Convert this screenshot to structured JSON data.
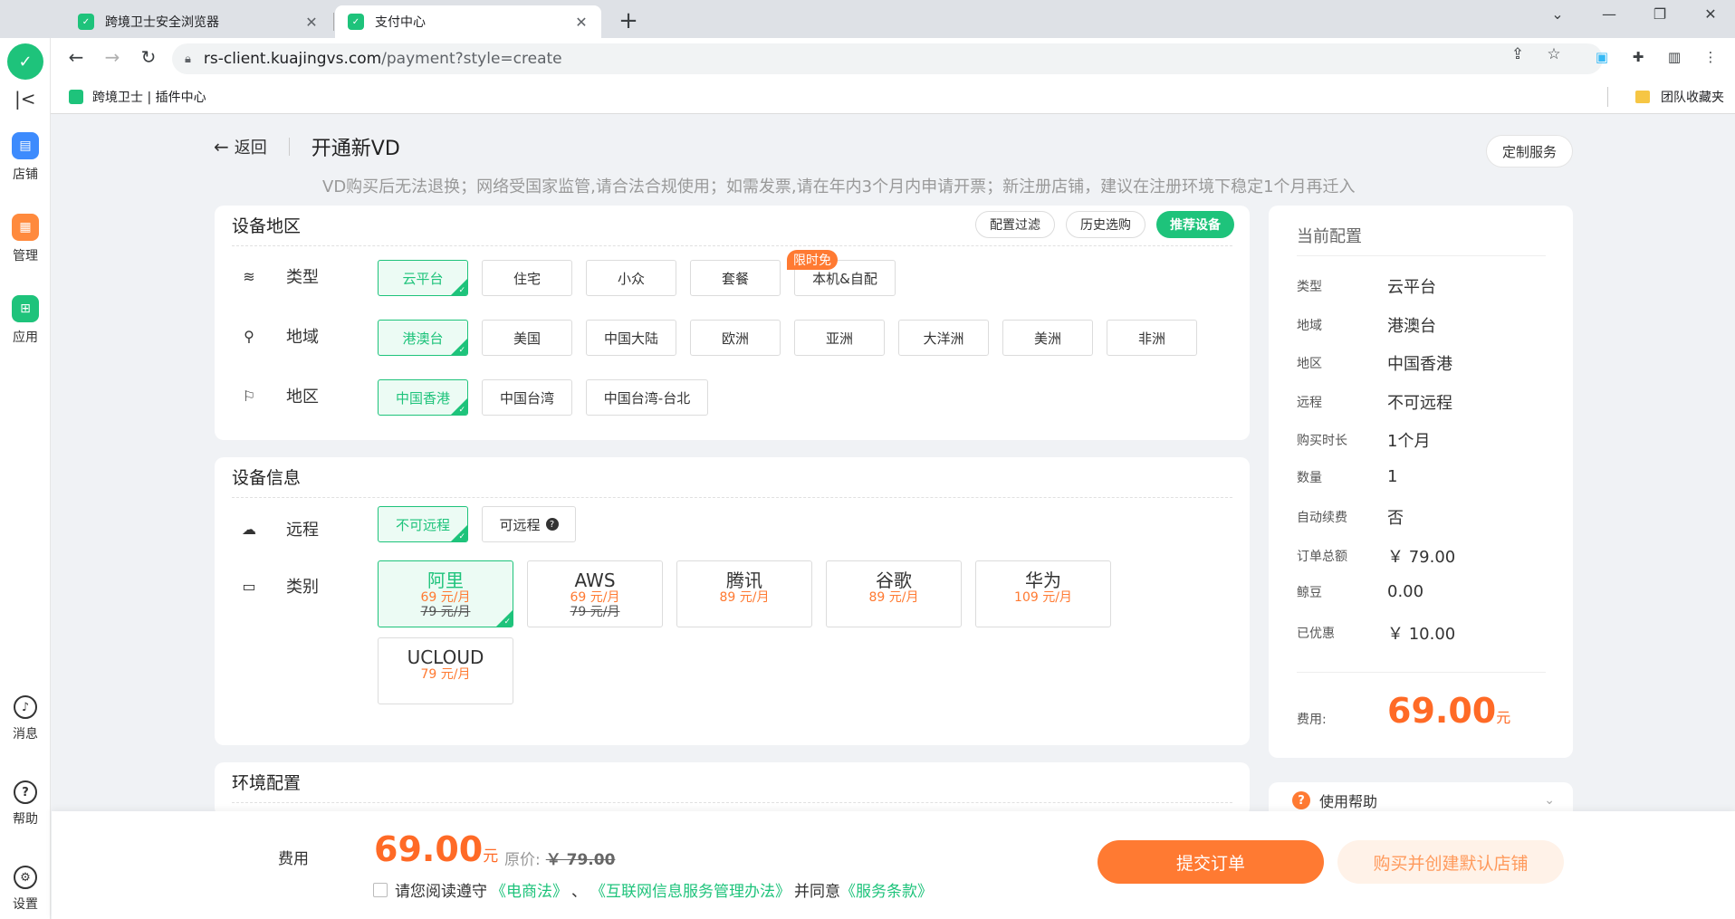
{
  "browser": {
    "tabs": [
      {
        "title": "跨境卫士安全浏览器",
        "active": false
      },
      {
        "title": "支付中心",
        "active": true
      }
    ],
    "url_host": "rs-client.kuajingvs.com",
    "url_path": "/payment?style=create",
    "bookmarks": {
      "left_label": "跨境卫士 | 插件中心",
      "right_label": "团队收藏夹"
    }
  },
  "sidebar": {
    "items": [
      {
        "label": "店铺",
        "color": "#3d8bfd"
      },
      {
        "label": "管理",
        "color": "#ff8a3d"
      },
      {
        "label": "应用",
        "color": "#1ec37b"
      }
    ],
    "bottom_items": [
      {
        "label": "消息"
      },
      {
        "label": "帮助"
      },
      {
        "label": "设置"
      }
    ]
  },
  "header": {
    "back_label": "返回",
    "title": "开通新VD",
    "notice": "VD购买后无法退换；网络受国家监管,请合法合规使用；如需发票,请在年内3个月内申请开票；新注册店铺，建议在注册环境下稳定1个月再迁入",
    "custom_service": "定制服务"
  },
  "region_card": {
    "title": "设备地区",
    "actions": [
      "配置过滤",
      "历史选购",
      "推荐设备"
    ],
    "type": {
      "label": "类型",
      "options": [
        "云平台",
        "住宅",
        "小众",
        "套餐",
        "本机&自配"
      ],
      "selected": "云平台",
      "badge": "限时免"
    },
    "area": {
      "label": "地域",
      "options": [
        "港澳台",
        "美国",
        "中国大陆",
        "欧洲",
        "亚洲",
        "大洋洲",
        "美洲",
        "非洲"
      ],
      "selected": "港澳台"
    },
    "region": {
      "label": "地区",
      "options": [
        "中国香港",
        "中国台湾",
        "中国台湾-台北"
      ],
      "selected": "中国香港"
    }
  },
  "device_card": {
    "title": "设备信息",
    "remote": {
      "label": "远程",
      "options": [
        "不可远程",
        "可远程"
      ],
      "selected": "不可远程"
    },
    "category": {
      "label": "类别",
      "vendors": [
        {
          "name": "阿里",
          "price": "69 元/月",
          "orig": "79 元/月",
          "selected": true
        },
        {
          "name": "AWS",
          "price": "69 元/月",
          "orig": "79 元/月",
          "selected": false
        },
        {
          "name": "腾讯",
          "price": "89 元/月",
          "orig": "",
          "selected": false
        },
        {
          "name": "谷歌",
          "price": "89 元/月",
          "orig": "",
          "selected": false
        },
        {
          "name": "华为",
          "price": "109 元/月",
          "orig": "",
          "selected": false
        },
        {
          "name": "UCLOUD",
          "price": "79 元/月",
          "orig": "",
          "selected": false
        }
      ]
    }
  },
  "env_card": {
    "title": "环境配置"
  },
  "summary": {
    "title": "当前配置",
    "rows": [
      {
        "k": "类型",
        "v": "云平台"
      },
      {
        "k": "地域",
        "v": "港澳台"
      },
      {
        "k": "地区",
        "v": "中国香港"
      },
      {
        "k": "远程",
        "v": "不可远程"
      },
      {
        "k": "购买时长",
        "v": "1个月"
      },
      {
        "k": "数量",
        "v": "1"
      },
      {
        "k": "自动续费",
        "v": "否"
      },
      {
        "k": "订单总额",
        "v": "￥ 79.00"
      },
      {
        "k": "鲸豆",
        "v": "0.00"
      },
      {
        "k": "已优惠",
        "v": "￥ 10.00"
      }
    ],
    "fee_label": "费用:",
    "fee_value": "69.00",
    "fee_unit": "元"
  },
  "help": {
    "label": "使用帮助"
  },
  "bottom": {
    "fee_label": "费用",
    "fee_value": "69.00",
    "fee_unit": "元",
    "orig_label": "原价:",
    "orig_value": "￥ 79.00",
    "agree_prefix": "请您阅读遵守",
    "link1": "《电商法》",
    "sep": "、",
    "link2": "《互联网信息服务管理办法》",
    "agree_mid": "并同意",
    "link3": "《服务条款》",
    "submit": "提交订单",
    "create": "购买并创建默认店铺"
  },
  "colors": {
    "brand_green": "#1ec37b",
    "accent_orange": "#ff7a32"
  }
}
